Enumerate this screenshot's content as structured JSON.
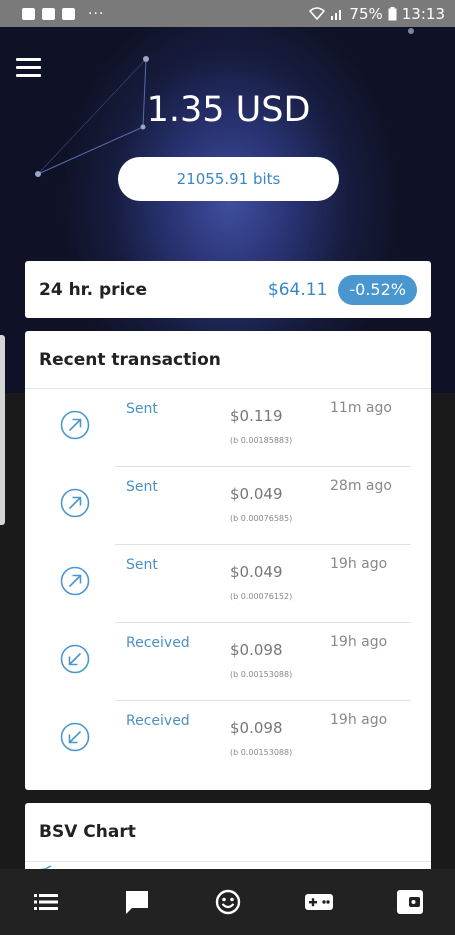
{
  "status_bar": {
    "battery_percent": "75%",
    "time": "13:13",
    "overflow_dots": "···"
  },
  "hero": {
    "balance_usd": "1.35 USD",
    "balance_bits": "21055.91 bits"
  },
  "price": {
    "label": "24 hr. price",
    "value": "$64.11",
    "change": "-0.52%"
  },
  "transactions": {
    "title": "Recent transaction",
    "items": [
      {
        "type": "Sent",
        "direction": "out",
        "amount": "$0.119",
        "btc": "(b 0.00185883)",
        "time": "11m ago"
      },
      {
        "type": "Sent",
        "direction": "out",
        "amount": "$0.049",
        "btc": "(b 0.00076585)",
        "time": "28m ago"
      },
      {
        "type": "Sent",
        "direction": "out",
        "amount": "$0.049",
        "btc": "(b 0.00076152)",
        "time": "19h ago"
      },
      {
        "type": "Received",
        "direction": "in",
        "amount": "$0.098",
        "btc": "(b 0.00153088)",
        "time": "19h ago"
      },
      {
        "type": "Received",
        "direction": "in",
        "amount": "$0.098",
        "btc": "(b 0.00153088)",
        "time": "19h ago"
      }
    ]
  },
  "chart": {
    "title": "BSV Chart"
  },
  "nav": {
    "items": [
      "list-icon",
      "chat-icon",
      "smiley-icon",
      "gamepad-icon",
      "wallet-icon"
    ]
  },
  "colors": {
    "accent": "#3a87c4",
    "badge": "#4a97cf",
    "hero_dark": "#0f1226",
    "hero_glow": "#3f4f9e",
    "nav_bg": "#222222"
  }
}
